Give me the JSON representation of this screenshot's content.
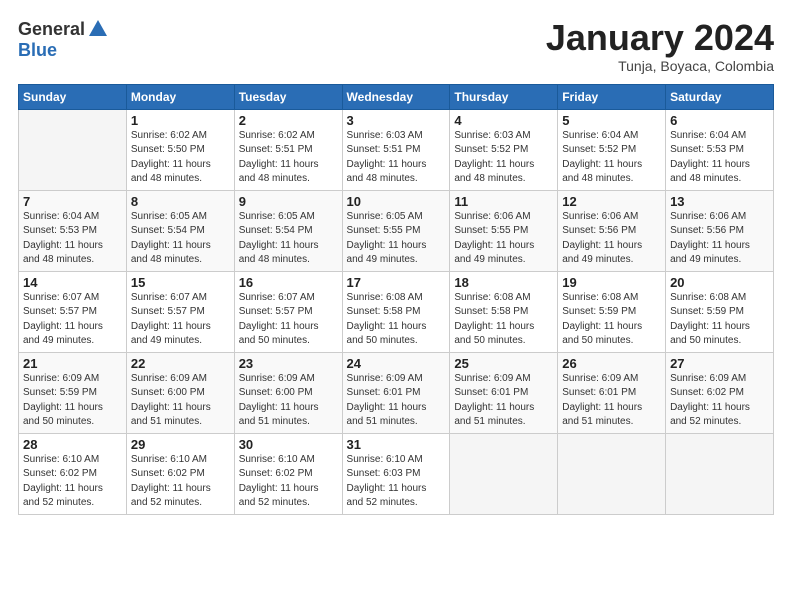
{
  "logo": {
    "general": "General",
    "blue": "Blue"
  },
  "title": "January 2024",
  "subtitle": "Tunja, Boyaca, Colombia",
  "headers": [
    "Sunday",
    "Monday",
    "Tuesday",
    "Wednesday",
    "Thursday",
    "Friday",
    "Saturday"
  ],
  "weeks": [
    [
      {
        "day": "",
        "info": ""
      },
      {
        "day": "1",
        "info": "Sunrise: 6:02 AM\nSunset: 5:50 PM\nDaylight: 11 hours\nand 48 minutes."
      },
      {
        "day": "2",
        "info": "Sunrise: 6:02 AM\nSunset: 5:51 PM\nDaylight: 11 hours\nand 48 minutes."
      },
      {
        "day": "3",
        "info": "Sunrise: 6:03 AM\nSunset: 5:51 PM\nDaylight: 11 hours\nand 48 minutes."
      },
      {
        "day": "4",
        "info": "Sunrise: 6:03 AM\nSunset: 5:52 PM\nDaylight: 11 hours\nand 48 minutes."
      },
      {
        "day": "5",
        "info": "Sunrise: 6:04 AM\nSunset: 5:52 PM\nDaylight: 11 hours\nand 48 minutes."
      },
      {
        "day": "6",
        "info": "Sunrise: 6:04 AM\nSunset: 5:53 PM\nDaylight: 11 hours\nand 48 minutes."
      }
    ],
    [
      {
        "day": "7",
        "info": "Sunrise: 6:04 AM\nSunset: 5:53 PM\nDaylight: 11 hours\nand 48 minutes."
      },
      {
        "day": "8",
        "info": "Sunrise: 6:05 AM\nSunset: 5:54 PM\nDaylight: 11 hours\nand 48 minutes."
      },
      {
        "day": "9",
        "info": "Sunrise: 6:05 AM\nSunset: 5:54 PM\nDaylight: 11 hours\nand 48 minutes."
      },
      {
        "day": "10",
        "info": "Sunrise: 6:05 AM\nSunset: 5:55 PM\nDaylight: 11 hours\nand 49 minutes."
      },
      {
        "day": "11",
        "info": "Sunrise: 6:06 AM\nSunset: 5:55 PM\nDaylight: 11 hours\nand 49 minutes."
      },
      {
        "day": "12",
        "info": "Sunrise: 6:06 AM\nSunset: 5:56 PM\nDaylight: 11 hours\nand 49 minutes."
      },
      {
        "day": "13",
        "info": "Sunrise: 6:06 AM\nSunset: 5:56 PM\nDaylight: 11 hours\nand 49 minutes."
      }
    ],
    [
      {
        "day": "14",
        "info": "Sunrise: 6:07 AM\nSunset: 5:57 PM\nDaylight: 11 hours\nand 49 minutes."
      },
      {
        "day": "15",
        "info": "Sunrise: 6:07 AM\nSunset: 5:57 PM\nDaylight: 11 hours\nand 49 minutes."
      },
      {
        "day": "16",
        "info": "Sunrise: 6:07 AM\nSunset: 5:57 PM\nDaylight: 11 hours\nand 50 minutes."
      },
      {
        "day": "17",
        "info": "Sunrise: 6:08 AM\nSunset: 5:58 PM\nDaylight: 11 hours\nand 50 minutes."
      },
      {
        "day": "18",
        "info": "Sunrise: 6:08 AM\nSunset: 5:58 PM\nDaylight: 11 hours\nand 50 minutes."
      },
      {
        "day": "19",
        "info": "Sunrise: 6:08 AM\nSunset: 5:59 PM\nDaylight: 11 hours\nand 50 minutes."
      },
      {
        "day": "20",
        "info": "Sunrise: 6:08 AM\nSunset: 5:59 PM\nDaylight: 11 hours\nand 50 minutes."
      }
    ],
    [
      {
        "day": "21",
        "info": "Sunrise: 6:09 AM\nSunset: 5:59 PM\nDaylight: 11 hours\nand 50 minutes."
      },
      {
        "day": "22",
        "info": "Sunrise: 6:09 AM\nSunset: 6:00 PM\nDaylight: 11 hours\nand 51 minutes."
      },
      {
        "day": "23",
        "info": "Sunrise: 6:09 AM\nSunset: 6:00 PM\nDaylight: 11 hours\nand 51 minutes."
      },
      {
        "day": "24",
        "info": "Sunrise: 6:09 AM\nSunset: 6:01 PM\nDaylight: 11 hours\nand 51 minutes."
      },
      {
        "day": "25",
        "info": "Sunrise: 6:09 AM\nSunset: 6:01 PM\nDaylight: 11 hours\nand 51 minutes."
      },
      {
        "day": "26",
        "info": "Sunrise: 6:09 AM\nSunset: 6:01 PM\nDaylight: 11 hours\nand 51 minutes."
      },
      {
        "day": "27",
        "info": "Sunrise: 6:09 AM\nSunset: 6:02 PM\nDaylight: 11 hours\nand 52 minutes."
      }
    ],
    [
      {
        "day": "28",
        "info": "Sunrise: 6:10 AM\nSunset: 6:02 PM\nDaylight: 11 hours\nand 52 minutes."
      },
      {
        "day": "29",
        "info": "Sunrise: 6:10 AM\nSunset: 6:02 PM\nDaylight: 11 hours\nand 52 minutes."
      },
      {
        "day": "30",
        "info": "Sunrise: 6:10 AM\nSunset: 6:02 PM\nDaylight: 11 hours\nand 52 minutes."
      },
      {
        "day": "31",
        "info": "Sunrise: 6:10 AM\nSunset: 6:03 PM\nDaylight: 11 hours\nand 52 minutes."
      },
      {
        "day": "",
        "info": ""
      },
      {
        "day": "",
        "info": ""
      },
      {
        "day": "",
        "info": ""
      }
    ]
  ]
}
